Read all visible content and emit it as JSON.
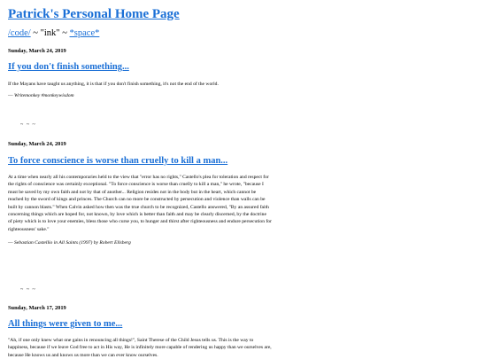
{
  "site": {
    "title": "Patrick's Personal Home Page"
  },
  "nav": {
    "code_link": "/code/",
    "sep1": " ~ ",
    "ink_text": "\"ink\"",
    "sep2": " ~ ",
    "space_link": "*space*"
  },
  "posts": [
    {
      "date": "Sunday, March 24, 2019",
      "title": "If you don't finish something...",
      "body": "If the Mayans have taught us anything, it is that if you don't finish something, it's not the end of the world.",
      "source_prefix": "— ",
      "source_rest": "Writemonkey #monkeywisdom"
    },
    {
      "date": "Sunday, March 24, 2019",
      "title": "To force conscience is worse than cruelly to kill a man...",
      "body": "At a time when nearly all his contemporaries held to the view that \"error has no rights,\" Castello's plea for toleration and respect for the rights of conscience was certainly exceptional. \"To force conscience is worse than cruelly to kill a man,\" he wrote, \"because I must be saved by my own faith and not by that of another... Religion resides not in the body but in the heart, which cannot be reached by the sword of kings and princes. The Church can no more be constructed by persecution and violence than walls can be built by cannon blasts.\" When Calvin asked how then was the true church to be recognized, Castello answered, \"By an assured faith concerning things which are hoped for, not known, by love which is better than faith and may be clearly discerned, by the doctrine of piety which is to love your enemies, bless those who curse you, to hunger and thirst after righteousness and endure persecution for righteousness' sake.\"",
      "source_prefix": "— ",
      "source_rest": "Sebastian Castellio in All Saints (1997) by Robert Ellsberg"
    },
    {
      "date": "Sunday, March 17, 2019",
      "title": "All things were given to me...",
      "body": "\"Ah, if one only knew what one gains in renouncing all things!\", Saint Therese of the Child Jesus tells us. This is the way to happiness, because if we leave God free to act in His way, He is infinitely more capable of rendering us happy than we ourselves are, because He knows us and knows us more than we can ever know ourselves."
    }
  ],
  "divider": "~ ~ ~",
  "colors": {
    "link": "#1a6fd6",
    "text": "#000000",
    "background": "#ffffff"
  }
}
